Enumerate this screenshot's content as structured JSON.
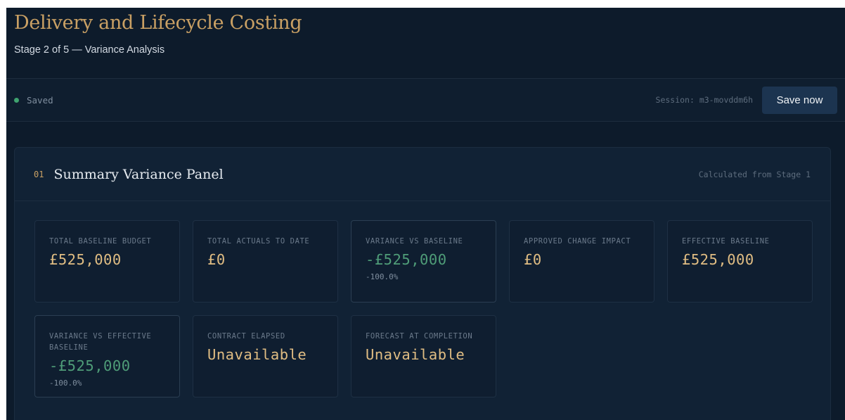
{
  "header": {
    "title": "Delivery and Lifecycle Costing",
    "subtitle": "Stage 2 of 5 — Variance Analysis"
  },
  "status": {
    "saved_label": "Saved",
    "session_label": "Session: m3-movddm6h",
    "save_button": "Save now",
    "colors": {
      "saved_dot": "#3fa36f",
      "accent": "#c9a064"
    }
  },
  "panel": {
    "number": "01",
    "title": "Summary Variance Panel",
    "note": "Calculated from Stage 1",
    "cards": [
      {
        "label": "TOTAL BASELINE BUDGET",
        "value": "£525,000",
        "sub": ""
      },
      {
        "label": "TOTAL ACTUALS TO DATE",
        "value": "£0",
        "sub": ""
      },
      {
        "label": "VARIANCE VS BASELINE",
        "value": "-£525,000",
        "sub": "-100.0%"
      },
      {
        "label": "APPROVED CHANGE IMPACT",
        "value": "£0",
        "sub": ""
      },
      {
        "label": "EFFECTIVE BASELINE",
        "value": "£525,000",
        "sub": ""
      },
      {
        "label": "VARIANCE VS EFFECTIVE BASELINE",
        "value": "-£525,000",
        "sub": "-100.0%"
      },
      {
        "label": "CONTRACT ELAPSED",
        "value": "Unavailable",
        "sub": ""
      },
      {
        "label": "FORECAST AT COMPLETION",
        "value": "Unavailable",
        "sub": ""
      }
    ]
  }
}
